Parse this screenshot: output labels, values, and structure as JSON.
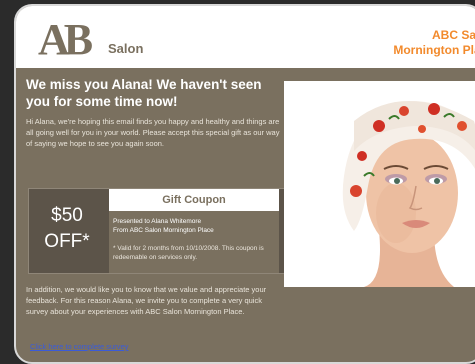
{
  "header": {
    "logo_big": "AB",
    "logo_small": "Salon",
    "salon_name": "ABC Salon",
    "location": "Mornington Place"
  },
  "email": {
    "headline": "We miss you Alana!  We haven't seen you for some time now!",
    "intro": "Hi Alana, we're hoping this email finds you happy and healthy and things are all going well for you in your world. Please accept this special gift as our way of saying we hope to see you again soon.",
    "followup": "In addition, we would like you to know that we value and appreciate your feedback. For this reason Alana, we invite you to complete a very quick survey about your experiences with ABC Salon Mornington Place.",
    "link": "Click here to complete survey"
  },
  "coupon": {
    "amount": "$50",
    "off": "OFF*",
    "title": "Gift Coupon",
    "presented_to": "Presented to Alana Whitemore",
    "from": "From ABC Salon Mornington Place",
    "valid": "* Valid for 2 months from 10/10/2008. This coupon is redeemable on services only."
  },
  "colors": {
    "panel": "#7a705f",
    "accent": "#f28a2c",
    "link": "#3b5bd8"
  }
}
